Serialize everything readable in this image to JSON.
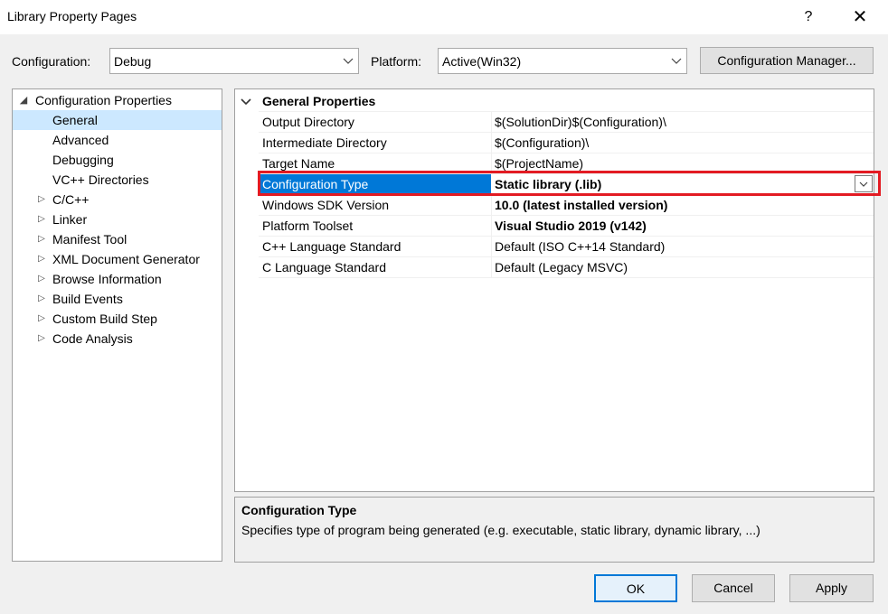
{
  "window": {
    "title": "Library Property Pages",
    "help_glyph": "?",
    "close_glyph": "✕"
  },
  "toolbar": {
    "configuration_label": "Configuration:",
    "configuration_value": "Debug",
    "platform_label": "Platform:",
    "platform_value": "Active(Win32)",
    "manager_button": "Configuration Manager..."
  },
  "tree": {
    "root": "Configuration Properties",
    "items": [
      {
        "label": "General"
      },
      {
        "label": "Advanced"
      },
      {
        "label": "Debugging"
      },
      {
        "label": "VC++ Directories"
      },
      {
        "label": "C/C++"
      },
      {
        "label": "Linker"
      },
      {
        "label": "Manifest Tool"
      },
      {
        "label": "XML Document Generator"
      },
      {
        "label": "Browse Information"
      },
      {
        "label": "Build Events"
      },
      {
        "label": "Custom Build Step"
      },
      {
        "label": "Code Analysis"
      }
    ],
    "selected": "General"
  },
  "grid": {
    "category": "General Properties",
    "rows": [
      {
        "name": "Output Directory",
        "value": "$(SolutionDir)$(Configuration)\\"
      },
      {
        "name": "Intermediate Directory",
        "value": "$(Configuration)\\"
      },
      {
        "name": "Target Name",
        "value": "$(ProjectName)"
      },
      {
        "name": "Configuration Type",
        "value": "Static library (.lib)"
      },
      {
        "name": "Windows SDK Version",
        "value": "10.0 (latest installed version)"
      },
      {
        "name": "Platform Toolset",
        "value": "Visual Studio 2019 (v142)"
      },
      {
        "name": "C++ Language Standard",
        "value": "Default (ISO C++14 Standard)"
      },
      {
        "name": "C Language Standard",
        "value": "Default (Legacy MSVC)"
      }
    ],
    "selected_row": "Configuration Type"
  },
  "description": {
    "title": "Configuration Type",
    "text": "Specifies type of program being generated (e.g. executable, static library, dynamic library, ...)"
  },
  "buttons": {
    "ok": "OK",
    "cancel": "Cancel",
    "apply": "Apply"
  },
  "colors": {
    "selection": "#0078d7",
    "tree_selection": "#cce8ff",
    "highlight_border": "#e31b23"
  }
}
